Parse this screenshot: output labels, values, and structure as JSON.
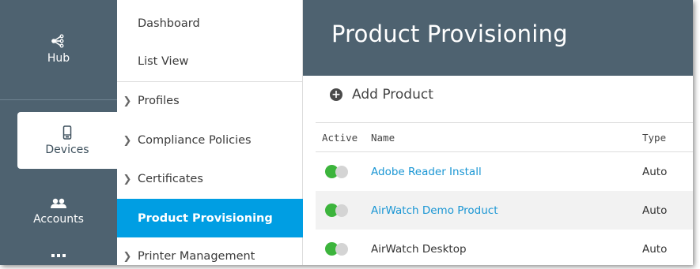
{
  "rail": {
    "items": [
      {
        "label": "Hub",
        "icon": "hub-icon"
      },
      {
        "label": "Devices",
        "icon": "device-icon"
      },
      {
        "label": "Accounts",
        "icon": "accounts-icon"
      },
      {
        "label": "",
        "icon": "more-icon"
      }
    ],
    "active": "Devices"
  },
  "submenu": {
    "items": [
      {
        "label": "Dashboard",
        "chevron": false
      },
      {
        "label": "List View",
        "chevron": false
      },
      {
        "label": "Profiles",
        "chevron": true
      },
      {
        "label": "Compliance Policies",
        "chevron": true
      },
      {
        "label": "Certificates",
        "chevron": true
      },
      {
        "label": "Product Provisioning",
        "chevron": false
      },
      {
        "label": "Printer Management",
        "chevron": true
      }
    ],
    "active": "Product Provisioning"
  },
  "page": {
    "title": "Product Provisioning",
    "add_label": "Add Product"
  },
  "grid": {
    "headers": {
      "active": "Active",
      "name": "Name",
      "type": "Type"
    },
    "rows": [
      {
        "name": "Adobe Reader Install",
        "type": "Auto",
        "active": true
      },
      {
        "name": "AirWatch Demo Product",
        "type": "Auto",
        "active": true
      },
      {
        "name": "AirWatch Desktop",
        "type": "Auto",
        "active": true
      }
    ]
  },
  "colors": {
    "rail_bg": "#4e6270",
    "header_bg": "#4e6270",
    "accent_blue": "#009ee3",
    "link_blue": "#1a96d4",
    "toggle_on": "#3cb43c"
  }
}
